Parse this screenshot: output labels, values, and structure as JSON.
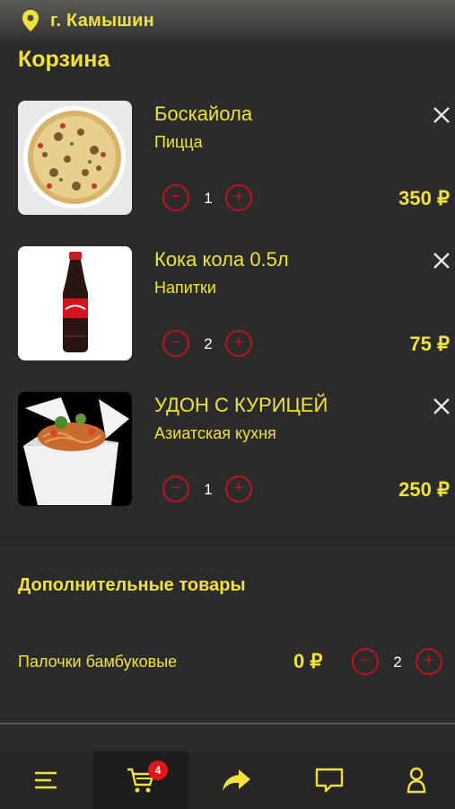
{
  "header": {
    "city": "г. Камышин"
  },
  "page": {
    "title": "Корзина"
  },
  "cart_items": [
    {
      "name": "Боскайола",
      "category": "Пицца",
      "qty": "1",
      "price": "350 ₽",
      "image": "pizza-image"
    },
    {
      "name": "Кока кола 0.5л",
      "category": "Напитки",
      "qty": "2",
      "price": "75 ₽",
      "image": "cola-bottle-image"
    },
    {
      "name": "УДОН С КУРИЦЕЙ",
      "category": "Азиатская кухня",
      "qty": "1",
      "price": "250 ₽",
      "image": "noodle-box-image"
    }
  ],
  "qty_controls": {
    "minus": "−",
    "plus": "+"
  },
  "extras": {
    "title": "Дополнительные товары",
    "items": [
      {
        "name": "Палочки бамбуковые",
        "price": "0 ₽",
        "qty": "2"
      }
    ]
  },
  "bottom_nav": {
    "items": [
      "menu-icon",
      "cart-icon",
      "share-arrow-icon",
      "chat-icon",
      "profile-icon"
    ],
    "cart_badge": "4"
  },
  "colors": {
    "accent": "#f2e13b",
    "danger": "#c1121f",
    "background": "#2b2b2b"
  }
}
